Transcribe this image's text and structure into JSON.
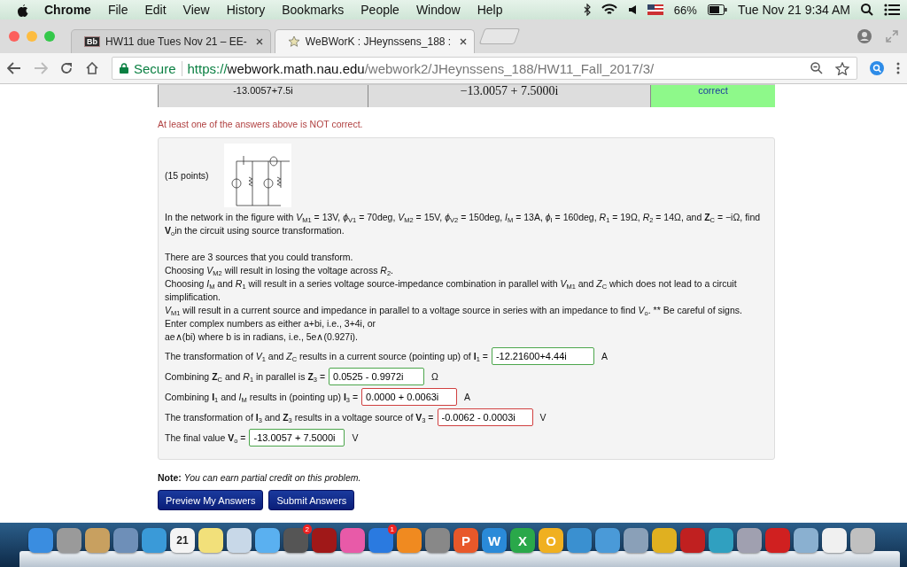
{
  "menubar": {
    "app": "Chrome",
    "items": [
      "File",
      "Edit",
      "View",
      "History",
      "Bookmarks",
      "People",
      "Window",
      "Help"
    ],
    "battery": "66%",
    "clock": "Tue Nov 21  9:34 AM"
  },
  "tabs": [
    {
      "favicon_text": "Bb",
      "title": "HW11 due Tues Nov 21 – EE-",
      "selected": false
    },
    {
      "title": "WeBWorK : JHeynssens_188 :",
      "selected": true
    }
  ],
  "address": {
    "secure": "Secure",
    "scheme": "https://",
    "host": "webwork.math.nau.edu",
    "path": "/webwork2/JHeynssens_188/HW11_Fall_2017/3/"
  },
  "results_row": {
    "entered": "-13.0057+7.5i",
    "preview": "−13.0057 + 7.5000i",
    "result": "correct",
    "correct": true
  },
  "message": "At least one of the answers above is NOT correct.",
  "problem": {
    "points": "(15 points)",
    "statement": "In the network in the figure with *V*$_{M1}$ = 13V, *ϕ*$_{V1}$ = 70deg, *V*$_{M2}$ = 15V, *ϕ*$_{V2}$ = 150deg, *I*$_{M}$ = 13A, *ϕ*$_{I}$ = 160deg, *R*$_{1}$ = 19Ω, *R*$_{2}$ = 14Ω, and **Z**$_{C}$ = −iΩ, find **V**$_{o}$in the circuit using source transformation.",
    "hints": [
      "There are 3 sources that you could transform.",
      "Choosing *V*$_{M2}$ will result in losing the voltage across *R*$_{2}$.",
      "Choosing *I*$_{M}$ and *R*$_{1}$ will result in a series voltage source-impedance combination in parallel with *V*$_{M1}$ and *Z*$_{C}$ which does not lead to a circuit simplification.",
      "*V*$_{M1}$ will result in a current source and impedance in parallel to a voltage source in series with an impedance to find *V*$_{o}$. ** Be careful of signs.",
      "Enter complex numbers as either a+bi, i.e., 3+4i, or",
      "ae∧(bi) where b is in radians, i.e., 5e∧(0.927i)."
    ],
    "answers": [
      {
        "label": "The transformation of *V*$_{1}$ and *Z*$_{C}$ results in a current source (pointing up) of **I**$_{1}$ =",
        "value": "-12.21600+4.44i",
        "correct": true,
        "unit": "A",
        "wide": true
      },
      {
        "label": "Combining **Z**$_{C}$ and *R*$_{1}$ in parallel is **Z**$_{3}$ =",
        "value": "0.0525 - 0.9972i",
        "correct": true,
        "unit": "Ω",
        "wide": false
      },
      {
        "label": "Combining **I**$_{1}$ and *I*$_{M}$ results in (pointing up) **I**$_{3}$ =",
        "value": "0.0000 + 0.0063i",
        "correct": false,
        "unit": "A",
        "wide": false
      },
      {
        "label": "The transformation of **I**$_{3}$ and **Z**$_{3}$ results in a voltage source of **V**$_{3}$ =",
        "value": "-0.0062 - 0.0003i",
        "correct": false,
        "unit": "V",
        "wide": false
      },
      {
        "label": "The final value **V**$_{o}$ =",
        "value": "-13.0057 + 7.5000i",
        "correct": true,
        "unit": "V",
        "wide": false
      }
    ]
  },
  "note": {
    "label": "Note:",
    "text": "You can earn partial credit on this problem."
  },
  "buttons": [
    "Preview My Answers",
    "Submit Answers"
  ],
  "dock": [
    {
      "color": "#3a8de0"
    },
    {
      "color": "#9a9a9a"
    },
    {
      "color": "#c8a060"
    },
    {
      "color": "#6e8fb8"
    },
    {
      "color": "#3a9ad8"
    },
    {
      "color": "#f4f4f4",
      "label": "21"
    },
    {
      "color": "#f2e07a"
    },
    {
      "color": "#c8d8e8"
    },
    {
      "color": "#5ab0f0"
    },
    {
      "color": "#555555",
      "badge": "2"
    },
    {
      "color": "#a01818"
    },
    {
      "color": "#e85aa8"
    },
    {
      "color": "#2a7ae0",
      "badge": "1"
    },
    {
      "color": "#f08a20"
    },
    {
      "color": "#888888"
    },
    {
      "color": "#e8582a",
      "label": "P"
    },
    {
      "color": "#2a8ad8",
      "label": "W"
    },
    {
      "color": "#2aa84a",
      "label": "X"
    },
    {
      "color": "#f0b020",
      "label": "O"
    },
    {
      "color": "#3a90d0"
    },
    {
      "color": "#4a9ad8"
    },
    {
      "color": "#8aa0b8"
    },
    {
      "color": "#e0b020"
    },
    {
      "color": "#c02020"
    },
    {
      "color": "#30a0c0"
    },
    {
      "color": "#a0a0b0"
    },
    {
      "color": "#d02020"
    },
    {
      "color": "#8ab0d0"
    },
    {
      "color": "#f0f0f0"
    },
    {
      "color": "#c0c0c0"
    }
  ]
}
